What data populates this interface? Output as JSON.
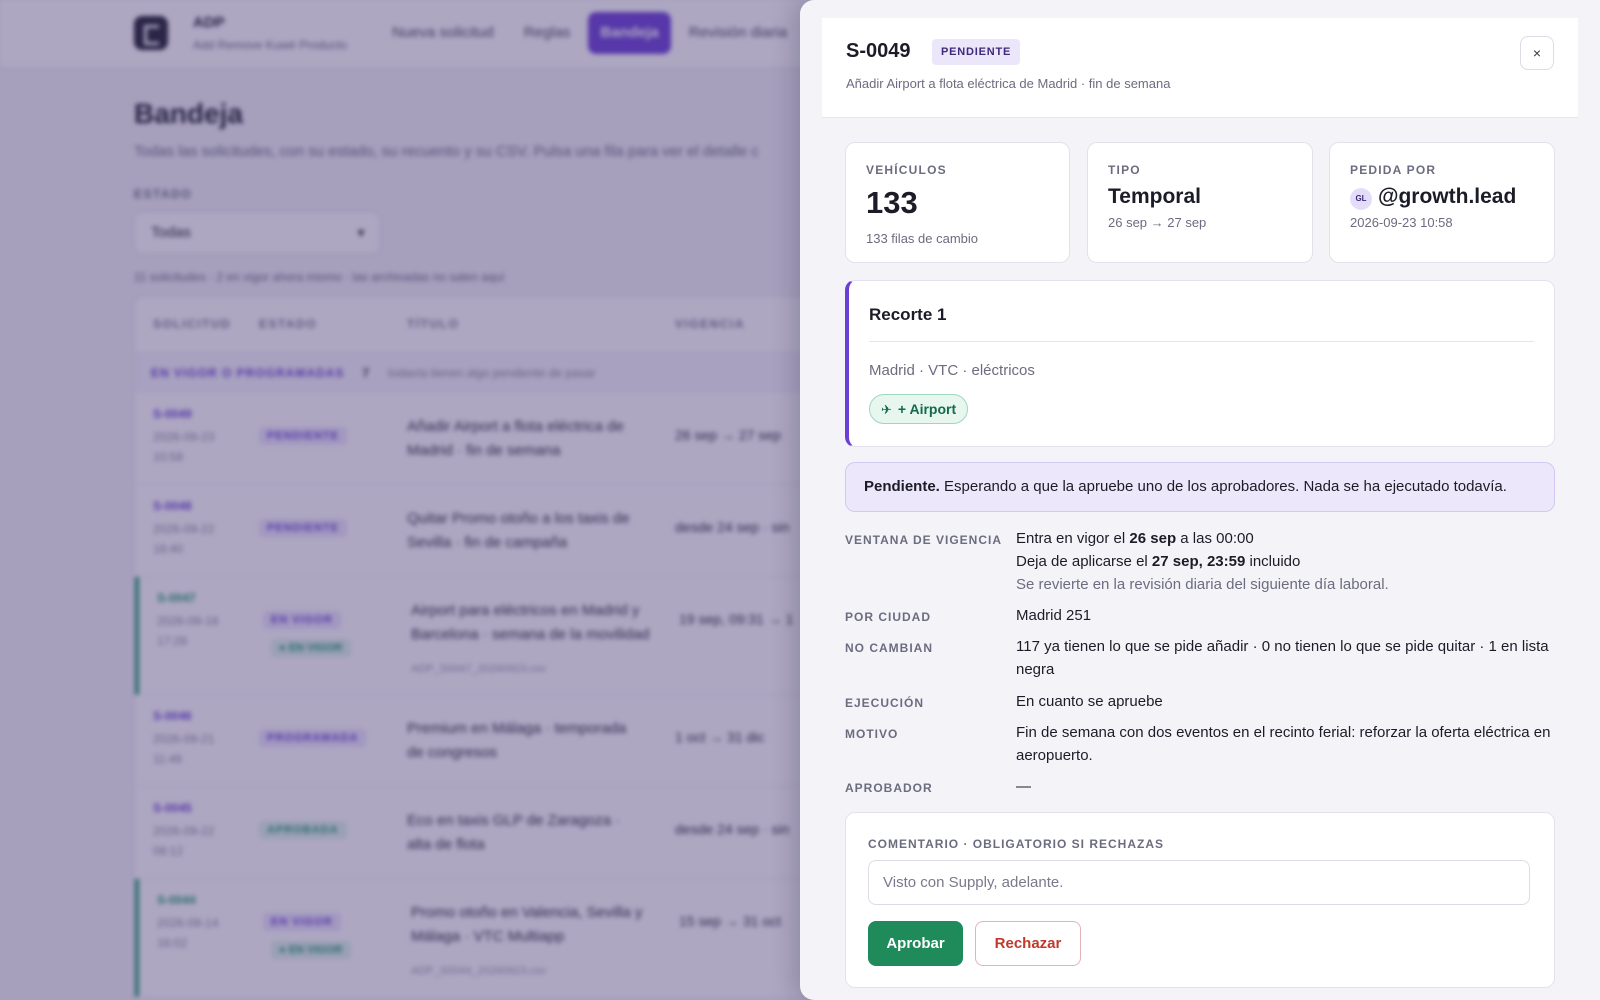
{
  "app": {
    "name": "ADP",
    "subtitle": "Add Remove Kuwé Producto",
    "nav": [
      "Nueva solicitud",
      "Reglas",
      "Bandeja",
      "Revisión diaria"
    ],
    "active_nav": "Bandeja"
  },
  "page": {
    "title": "Bandeja",
    "description": "Todas las solicitudes, con su estado, su recuento y su CSV. Pulsa una fila para ver el detalle c",
    "filter_label": "ESTADO",
    "filter_value": "Todas",
    "count_line": "11 solicitudes · 2 en vigor ahora mismo · las archivadas no salen aquí"
  },
  "table": {
    "columns": [
      "SOLICITUD",
      "ESTADO",
      "TÍTULO",
      "VIGENCIA"
    ],
    "group": {
      "label": "EN VIGOR O PROGRAMADAS",
      "count": "7",
      "note": "todavía tienen algo pendiente de pasar"
    },
    "rows": [
      {
        "id": "S-0049",
        "date": "2026-09-23 10:58",
        "status": "PENDIENTE",
        "status2": "",
        "title": "Añadir Airport a flota eléctrica de Madrid · fin de semana",
        "file": "",
        "vigencia": "26 sep → 27 sep"
      },
      {
        "id": "S-0048",
        "date": "2026-09-22 18:40",
        "status": "PENDIENTE",
        "status2": "",
        "title": "Quitar Promo otoño a los taxis de Sevilla · fin de campaña",
        "file": "",
        "vigencia": "desde 24 sep · sin"
      },
      {
        "id": "S-0047",
        "date": "2026-09-18 17:28",
        "status": "EN VIGOR",
        "status2": "● EN VIGOR",
        "title": "Airport para eléctricos en Madrid y Barcelona · semana de la movilidad",
        "file": "ADP_S0047_20260923.csv",
        "vigencia": "19 sep, 09:31 → 1"
      },
      {
        "id": "S-0046",
        "date": "2026-09-21 11:46",
        "status": "PROGRAMADA",
        "status2": "",
        "title": "Premium en Málaga · temporada de congresos",
        "file": "",
        "vigencia": "1 oct → 31 dic"
      },
      {
        "id": "S-0045",
        "date": "2026-09-22 08:12",
        "status": "APROBADA",
        "status2": "",
        "title": "Eco en taxis GLP de Zaragoza · alta de flota",
        "file": "",
        "vigencia": "desde 24 sep · sin"
      },
      {
        "id": "S-0044",
        "date": "2026-09-14 16:02",
        "status": "EN VIGOR",
        "status2": "● EN VIGOR",
        "title": "Promo otoño en Valencia, Sevilla y Málaga · VTC Multiapp",
        "file": "ADP_S0044_20260923.csv",
        "vigencia": "15 sep → 31 oct"
      }
    ]
  },
  "drawer": {
    "id": "S-0049",
    "status": "PENDIENTE",
    "subtitle": "Añadir Airport a flota eléctrica de Madrid · fin de semana",
    "close_icon": "×",
    "stats": {
      "vehiculos": {
        "label": "VEHÍCULOS",
        "value": "133",
        "sub": "133 filas de cambio"
      },
      "tipo": {
        "label": "TIPO",
        "value": "Temporal",
        "sub": "26 sep → 27 sep"
      },
      "pedida": {
        "label": "PEDIDA POR",
        "initials": "GL",
        "value": "@growth.lead",
        "sub": "2026-09-23 10:58"
      }
    },
    "recorte": {
      "title": "Recorte 1",
      "scope": "Madrid · VTC · eléctricos",
      "chip": "+ Airport",
      "chip_icon": "plane-icon"
    },
    "status_box": {
      "bold": "Pendiente.",
      "text": " Esperando a que la apruebe uno de los aprobadores. Nada se ha ejecutado todavía."
    },
    "details": {
      "ventana_label": "VENTANA DE VIGENCIA",
      "ventana_l1_a": "Entra en vigor el ",
      "ventana_l1_b": "26 sep",
      "ventana_l1_c": " a las 00:00",
      "ventana_l2_a": "Deja de aplicarse el ",
      "ventana_l2_b": "27 sep, 23:59",
      "ventana_l2_c": " incluido",
      "ventana_l3": "Se revierte en la revisión diaria del siguiente día laboral.",
      "ciudad_label": "POR CIUDAD",
      "ciudad_val": "Madrid 251",
      "nocambian_label": "NO CAMBIAN",
      "nocambian_val": "117 ya tienen lo que se pide añadir · 0 no tienen lo que se pide quitar · 1 en lista negra",
      "ejecucion_label": "EJECUCIÓN",
      "ejecucion_val": "En cuanto se apruebe",
      "motivo_label": "MOTIVO",
      "motivo_val": "Fin de semana con dos eventos en el recinto ferial: reforzar la oferta eléctrica en aeropuerto.",
      "aprobador_label": "APROBADOR",
      "aprobador_val": "—"
    },
    "comment": {
      "label": "COMENTARIO · OBLIGATORIO SI RECHAZAS",
      "placeholder": "Visto con Supply, adelante.",
      "approve": "Aprobar",
      "reject": "Rechazar"
    }
  },
  "colors": {
    "accent": "#6b3fd4",
    "approve": "#1f8a5a",
    "reject": "#c0392b",
    "live": "#1f9a6b"
  }
}
